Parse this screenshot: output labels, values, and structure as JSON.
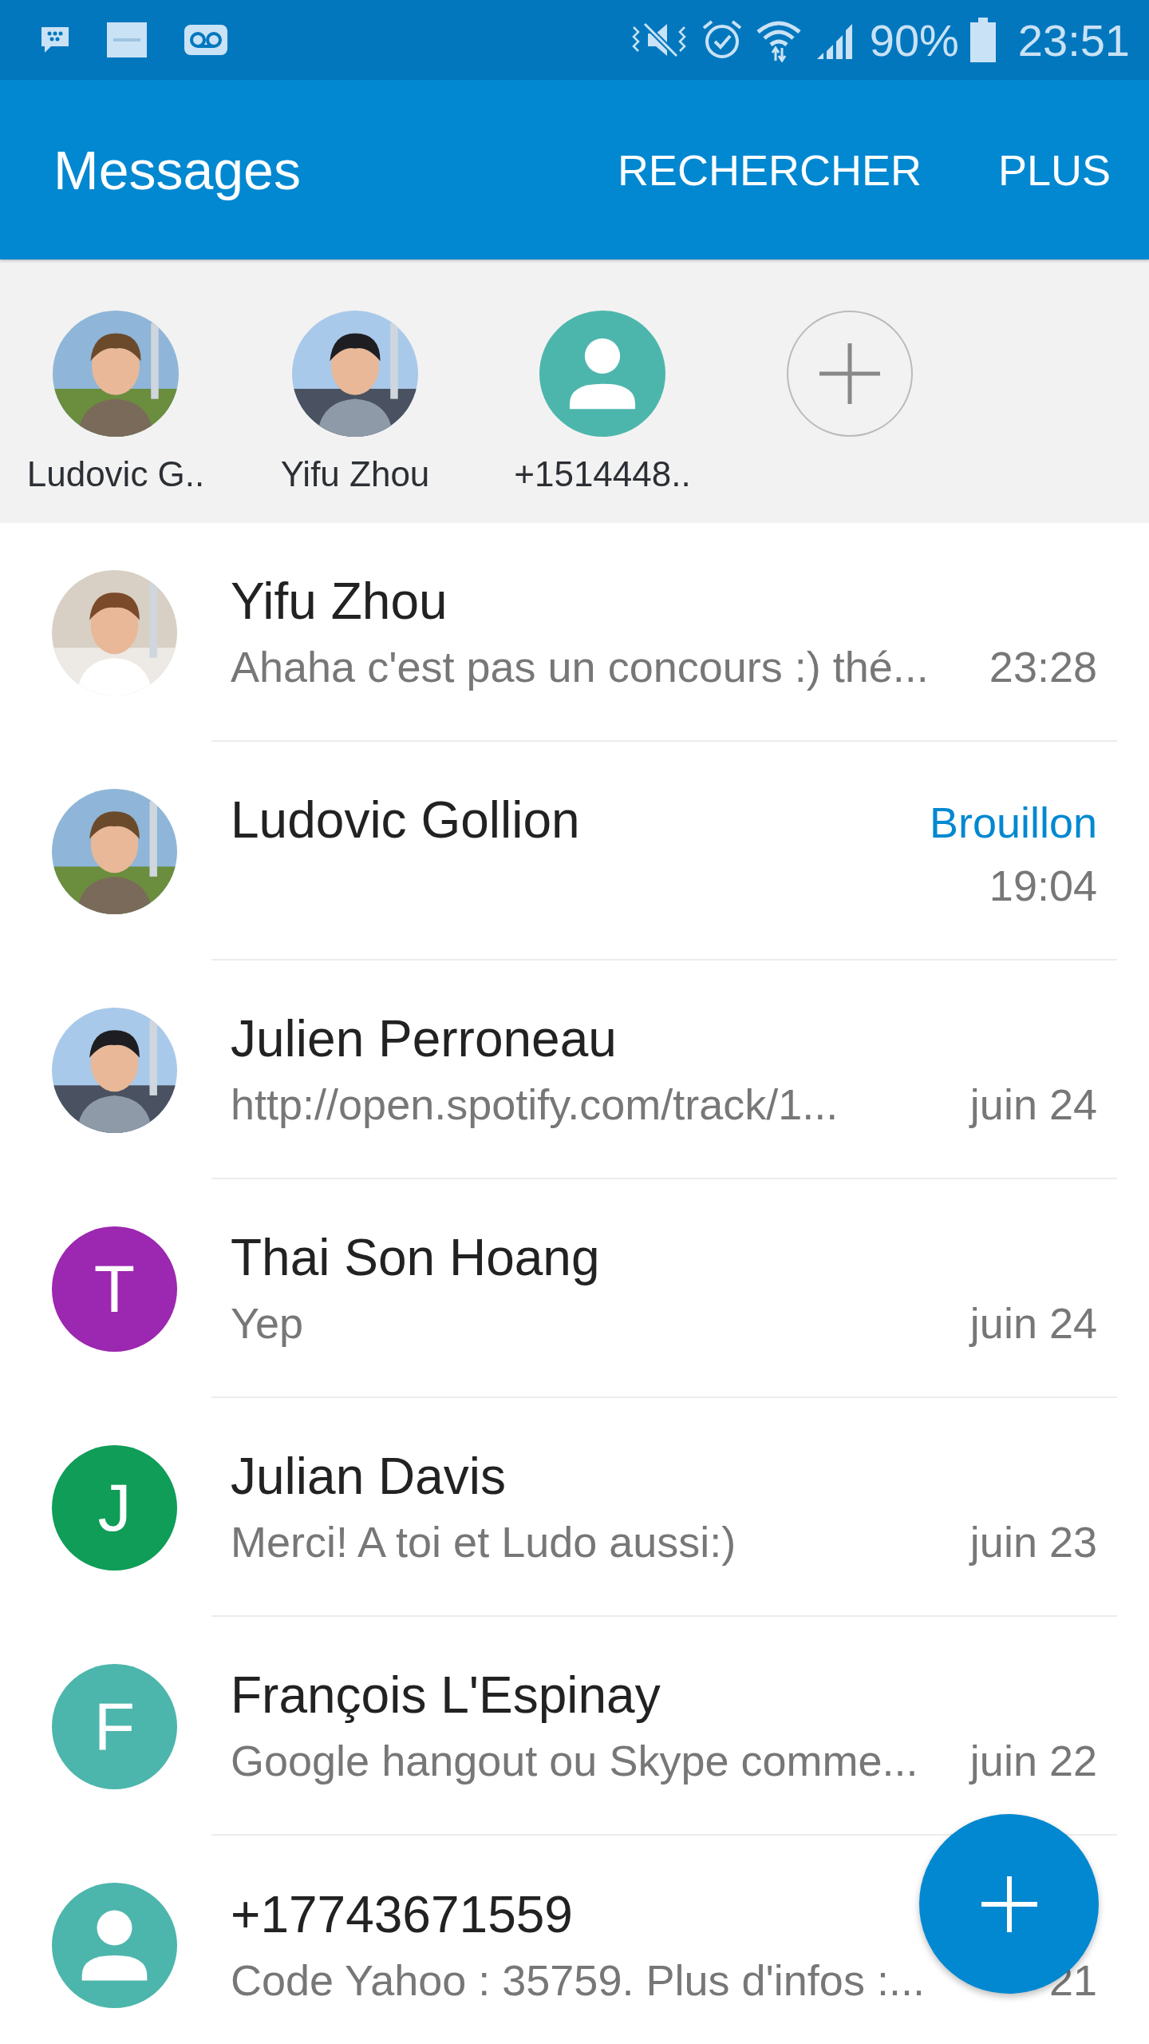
{
  "status_bar": {
    "battery": "90%",
    "time": "23:51"
  },
  "app_bar": {
    "title": "Messages",
    "actions": [
      "RECHERCHER",
      "PLUS"
    ]
  },
  "favorites": [
    {
      "label": "Ludovic G.."
    },
    {
      "label": "Yifu Zhou"
    },
    {
      "kind": "contact",
      "label": "+1514448..",
      "color": "#4db6ac"
    },
    {
      "kind": "add"
    }
  ],
  "conversations": [
    {
      "name": "Yifu Zhou",
      "preview": "Ahaha c'est pas un concours :) thé...",
      "time": "23:28"
    },
    {
      "name": "Ludovic Gollion",
      "draft": "Brouillon",
      "time": "19:04"
    },
    {
      "name": "Julien Perroneau",
      "preview": "http://open.spotify.com/track/1...",
      "time": "juin 24"
    },
    {
      "kind": "letter",
      "letter": "T",
      "color": "#9c27b0",
      "name": "Thai Son Hoang",
      "preview": "Yep",
      "time": "juin 24"
    },
    {
      "kind": "letter",
      "letter": "J",
      "color": "#0f9d58",
      "name": "Julian Davis",
      "preview": "Merci! A toi et Ludo aussi:)",
      "time": "juin 23"
    },
    {
      "kind": "letter",
      "letter": "F",
      "color": "#4db6ac",
      "name": "François L'Espinay",
      "preview": "Google hangout ou Skype comme...",
      "time": "juin 22"
    },
    {
      "kind": "contact",
      "color": "#4db6ac",
      "name": "+17743671559",
      "preview": "Code Yahoo : 35759. Plus d'infos :...",
      "time": "21"
    }
  ]
}
